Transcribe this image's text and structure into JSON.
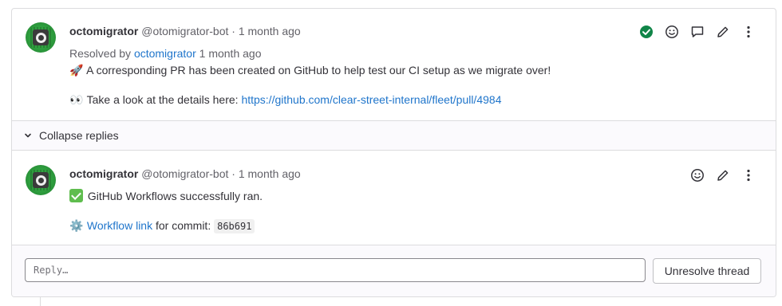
{
  "thread": {
    "first_note": {
      "author": "octomigrator",
      "handle": "@otomigrator-bot",
      "separator": "·",
      "time": "1 month ago",
      "resolved_prefix": "Resolved by",
      "resolved_by": "octomigrator",
      "resolved_time": "1 month ago",
      "line1_emoji": "🚀",
      "line1_text": "A corresponding PR has been created on GitHub to help test our CI setup as we migrate over!",
      "line2_emoji": "👀",
      "line2_text": "Take a look at the details here:",
      "line2_link": "https://github.com/clear-street-internal/fleet/pull/4984",
      "actions": [
        "resolved-check-icon",
        "smiley-icon",
        "comment-icon",
        "pencil-icon",
        "kebab-icon"
      ]
    },
    "collapse_label": "Collapse replies",
    "reply_note": {
      "author": "octomigrator",
      "handle": "@otomigrator-bot",
      "separator": "·",
      "time": "1 month ago",
      "line1_text": "GitHub Workflows successfully ran.",
      "line2_emoji": "⚙️",
      "line2_link": "Workflow link",
      "line2_text": "for commit:",
      "commit": "86b691",
      "actions": [
        "smiley-icon",
        "pencil-icon",
        "kebab-icon"
      ]
    },
    "reply_placeholder": "Reply…",
    "unresolve_label": "Unresolve thread"
  },
  "colors": {
    "link": "#1f75cb",
    "resolved_green": "#108548",
    "border": "#dcdcde"
  }
}
